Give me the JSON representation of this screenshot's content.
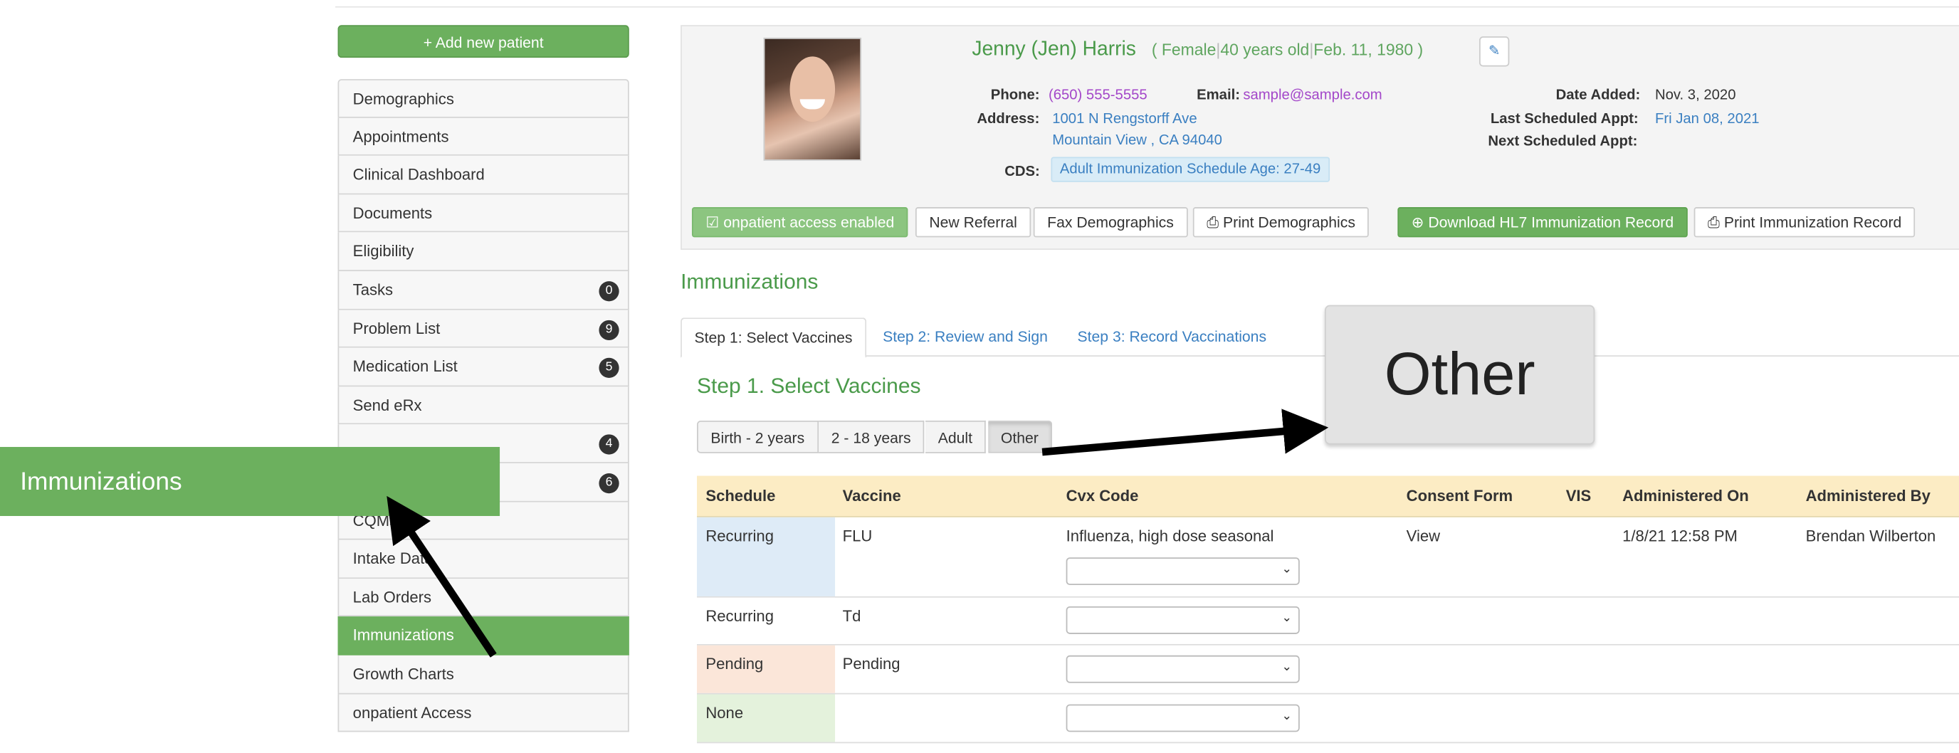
{
  "sidebar": {
    "add_button": "+ Add new patient",
    "items": [
      {
        "label": "Demographics",
        "badge": ""
      },
      {
        "label": "Appointments",
        "badge": ""
      },
      {
        "label": "Clinical Dashboard",
        "badge": ""
      },
      {
        "label": "Documents",
        "badge": ""
      },
      {
        "label": "Eligibility",
        "badge": ""
      },
      {
        "label": "Tasks",
        "badge": "0"
      },
      {
        "label": "Problem List",
        "badge": "9"
      },
      {
        "label": "Medication List",
        "badge": "5"
      },
      {
        "label": "Send eRx",
        "badge": ""
      },
      {
        "label": "",
        "badge": "4"
      },
      {
        "label": "",
        "badge": "6"
      },
      {
        "label": "CQMs",
        "badge": ""
      },
      {
        "label": "Intake Data",
        "badge": ""
      },
      {
        "label": "Lab Orders",
        "badge": ""
      },
      {
        "label": "Immunizations",
        "badge": "",
        "active": true
      },
      {
        "label": "Growth Charts",
        "badge": ""
      },
      {
        "label": "onpatient Access",
        "badge": ""
      }
    ]
  },
  "overlay": {
    "label": "Immunizations",
    "zoom_label": "Other"
  },
  "patient": {
    "name": "Jenny (Jen) Harris",
    "paren_open": "(",
    "sex": "Female",
    "age": "40 years old",
    "dob": "Feb. 11, 1980",
    "paren_close": ")",
    "sep": "|",
    "phone_label": "Phone:",
    "phone": "(650) 555-5555",
    "email_label": "Email:",
    "email": "sample@sample.com",
    "address_label": "Address:",
    "address1": "1001 N Rengstorff Ave",
    "address2": "Mountain View , CA 94040",
    "date_added_label": "Date Added:",
    "date_added": "Nov. 3, 2020",
    "last_appt_label": "Last Scheduled Appt:",
    "last_appt": "Fri Jan 08, 2021",
    "next_appt_label": "Next Scheduled Appt:",
    "cds_label": "CDS:",
    "cds": "Adult Immunization Schedule Age: 27-49"
  },
  "actions": {
    "onpatient": "onpatient access enabled",
    "new_referral": "New Referral",
    "fax_demo": "Fax Demographics",
    "print_demo": "Print Demographics",
    "download_hl7": "Download HL7 Immunization Record",
    "print_imm": "Print Immunization Record"
  },
  "main": {
    "title": "Immunizations",
    "tabs": [
      "Step 1: Select Vaccines",
      "Step 2: Review and Sign",
      "Step 3: Record Vaccinations"
    ],
    "step_title": "Step 1. Select Vaccines",
    "age_groups": [
      "Birth - 2 years",
      "2 - 18 years",
      "Adult",
      "Other"
    ],
    "selected_age_group": "Other"
  },
  "table": {
    "headers": [
      "Schedule",
      "Vaccine",
      "Cvx Code",
      "Consent Form",
      "VIS",
      "Administered On",
      "Administered By"
    ],
    "rows": [
      {
        "schedule": "Recurring",
        "vaccine": "FLU",
        "cvx": "Influenza, high dose seasonal",
        "consent": "View",
        "vis": "",
        "administered_on": "1/8/21 12:58 PM",
        "administered_by": "Brendan Wilberton",
        "color": "#deebf7"
      },
      {
        "schedule": "Recurring",
        "vaccine": "Td",
        "cvx": "",
        "consent": "",
        "vis": "",
        "administered_on": "",
        "administered_by": "",
        "color": "#deebf7"
      },
      {
        "schedule": "Pending",
        "vaccine": "Pending",
        "cvx": "",
        "consent": "",
        "vis": "",
        "administered_on": "",
        "administered_by": "",
        "color": "#fbe6d9"
      },
      {
        "schedule": "None",
        "vaccine": "",
        "cvx": "",
        "consent": "",
        "vis": "",
        "administered_on": "",
        "administered_by": "",
        "color": "#e4f2dc"
      }
    ]
  },
  "colors": {
    "accent_green": "#6cb05e",
    "link_blue": "#3a7fc1",
    "email_purple": "#a347c9",
    "table_header": "#fcecc4"
  }
}
